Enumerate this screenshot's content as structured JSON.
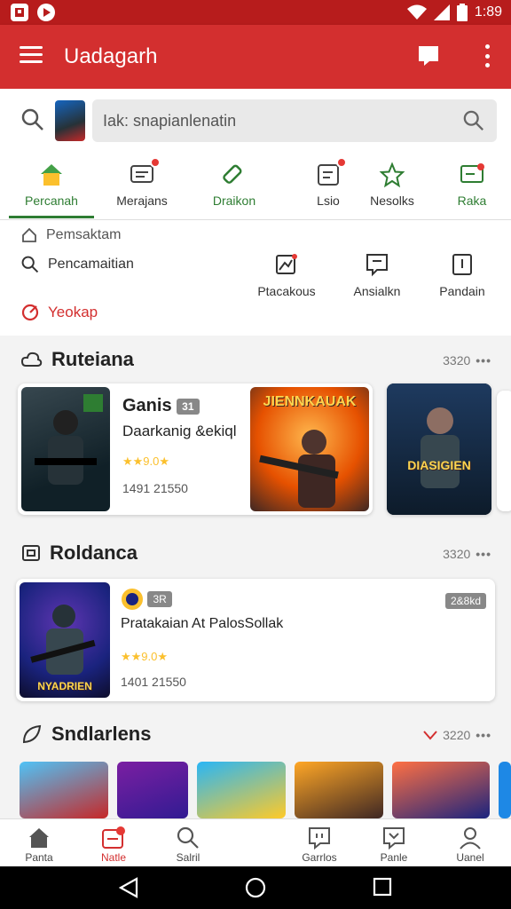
{
  "status_bar": {
    "time": "1:89",
    "icons": [
      "notification-icon",
      "play-icon",
      "wifi-icon",
      "signal-icon",
      "battery-icon"
    ]
  },
  "app_bar": {
    "title": "Uadagarh"
  },
  "search": {
    "placeholder": "Iak: snapianlenatin"
  },
  "categories": [
    {
      "label": "Percanah",
      "icon": "home-icon",
      "active": true
    },
    {
      "label": "Merajans",
      "icon": "message-icon",
      "badge": true
    },
    {
      "label": "Draikon",
      "icon": "tag-icon"
    },
    {
      "label": "Lsio",
      "icon": "document-icon",
      "badge": true
    },
    {
      "label": "Nesolks",
      "icon": "star-icon"
    },
    {
      "label": "Raka",
      "icon": "flag-icon"
    }
  ],
  "quick": {
    "item1": "Pemsaktam",
    "item2": "Pencamaitian",
    "item3": "Yeokap",
    "actions": [
      "Ptacakous",
      "Ansialkn",
      "Pandain"
    ]
  },
  "section1": {
    "title": "Ruteiana",
    "more": "3320",
    "card": {
      "title": "Ganis",
      "tag": "31",
      "subtitle": "Daarkanig &ekiql",
      "rating": "★★9.0★",
      "meta": "1491 21550",
      "banner": "JIENNKAUAK",
      "card3_caption": "DIASIGIEN"
    }
  },
  "section2": {
    "title": "Roldanca",
    "more": "3320",
    "card": {
      "tag": "3R",
      "badge": "2&8kd",
      "title": "Pratakaian At PalosSollak",
      "rating": "★★9.0★",
      "meta": "1401 21550",
      "art_caption": "NYADRIEN"
    }
  },
  "section3": {
    "title": "Sndlarlens",
    "more": "3220"
  },
  "bottom_nav": [
    {
      "label": "Panta"
    },
    {
      "label": "Natle",
      "active": true
    },
    {
      "label": "Salril"
    },
    {
      "label": "Garrlos"
    },
    {
      "label": "Panle"
    },
    {
      "label": "Uanel"
    }
  ],
  "colors": {
    "primary": "#d32f2f",
    "status": "#b71c1c",
    "accent_green": "#2e7d32"
  }
}
